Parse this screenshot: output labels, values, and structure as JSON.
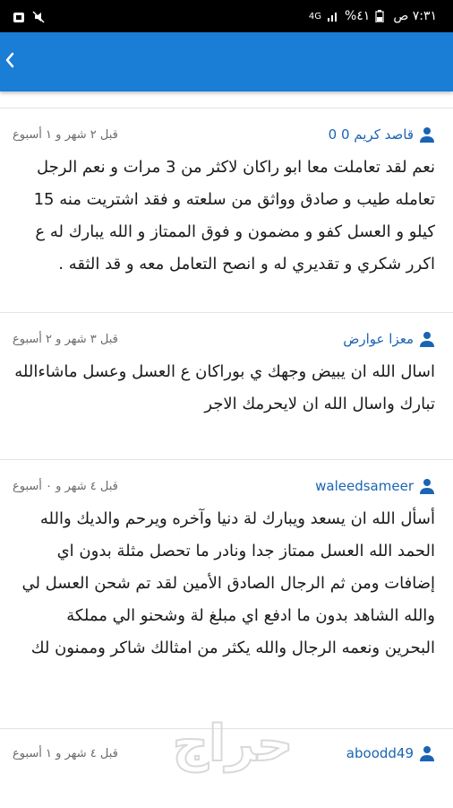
{
  "status_bar": {
    "time": "٧:٣١ ص",
    "battery": "%٤١",
    "network": "4G"
  },
  "app_bar": {
    "back_icon": "chevron-left-icon"
  },
  "comments": [
    {
      "user": "0 قاصد كريم 0",
      "time": "قبل ٢ شهر و ١ أسبوع",
      "text": "نعم لقد تعاملت معا ابو راكان لاكثر من 3 مرات و نعم الرجل تعامله طيب و صادق وواثق من سلعته و فقد اشتريت منه 15 كيلو و العسل كفو و مضمون و فوق الممتاز و الله يبارك له ع اكرر شكري و تقديري له و انصح التعامل معه و قد الثقه ."
    },
    {
      "user": "معزا عوارض",
      "time": "قبل ٣ شهر و ٢ أسبوع",
      "text": "اسال الله ان يبيض وجهك ي بوراكان ع العسل وعسل ماشاءالله تبارك واسال الله ان لايحرمك الاجر"
    },
    {
      "user": "waleedsameer",
      "time": "قبل ٤ شهر و ٠ أسبوع",
      "text": "أسأل الله ان يسعد ويبارك لة دنيا وآخره ويرحم والديك والله الحمد الله العسل ممتاز جدا ونادر ما تحصل مثلة بدون اي إضافات ومن ثم الرجال الصادق الأمين لقد تم شحن العسل لي والله الشاهد بدون ما ادفع اي مبلغ لة وشحنو الي مملكة البحرين ونعمه الرجال والله يكثر من امثالك شاكر وممنون لك"
    },
    {
      "user": "aboodd49",
      "time": "قبل ٤ شهر و ١ أسبوع",
      "text": ""
    }
  ],
  "watermark": "حراج"
}
